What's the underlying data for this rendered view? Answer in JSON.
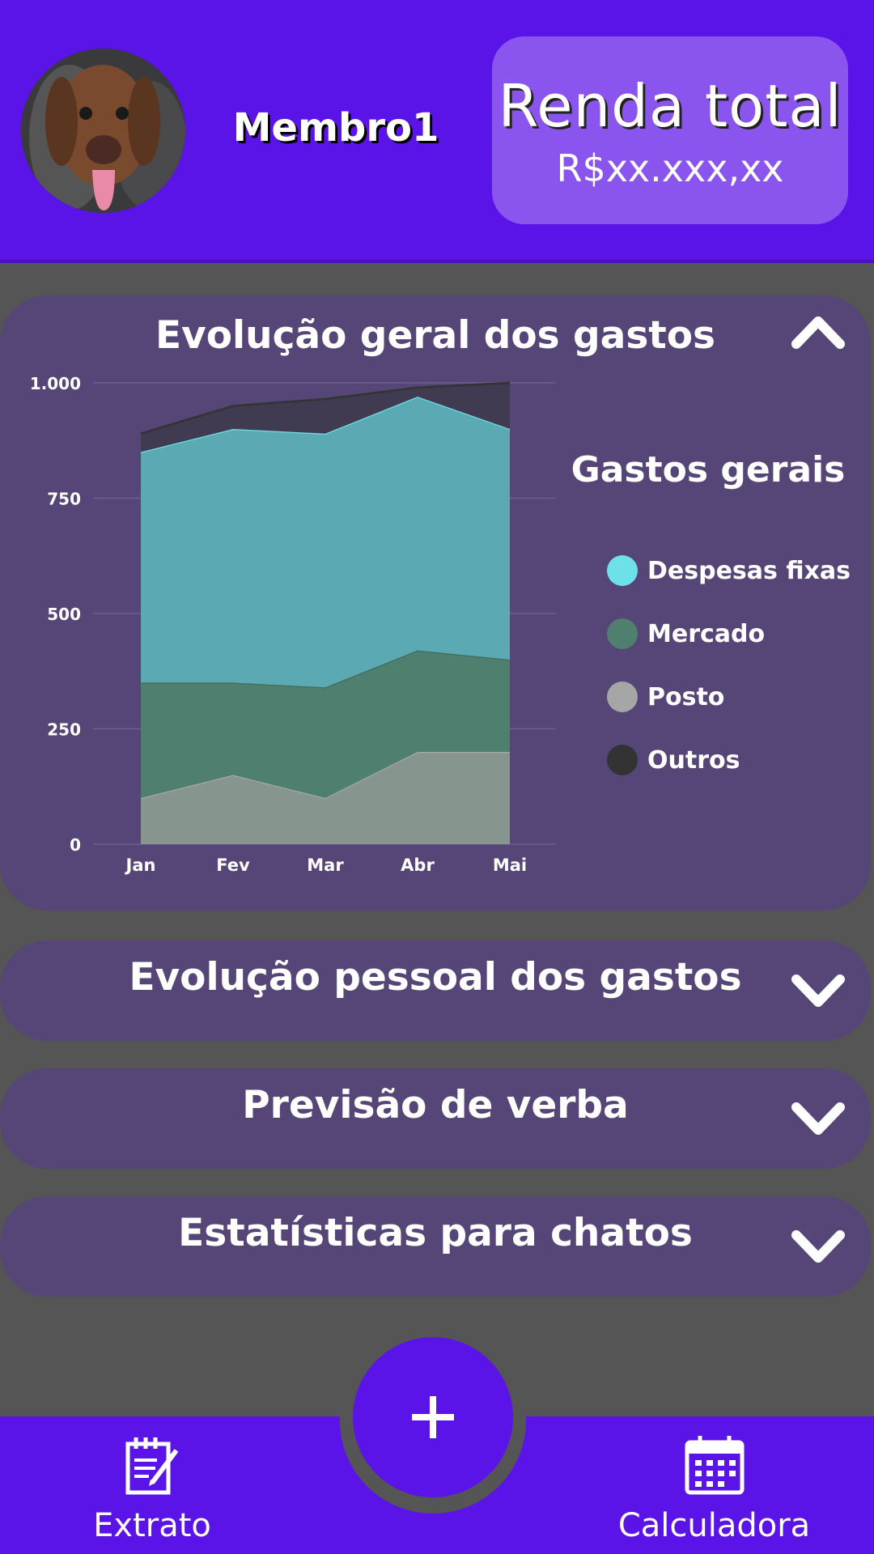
{
  "header": {
    "member_name": "Membro1",
    "income_title": "Renda total",
    "income_value": "R$xx.xxx,xx"
  },
  "sections": [
    {
      "title": "Evolução geral dos gastos",
      "expanded": true
    },
    {
      "title": "Evolução pessoal dos gastos",
      "expanded": false
    },
    {
      "title": "Previsão de verba",
      "expanded": false
    },
    {
      "title": "Estatísticas para chatos",
      "expanded": false
    }
  ],
  "legend": {
    "title": "Gastos gerais",
    "items": [
      "Despesas fixas",
      "Mercado",
      "Posto",
      "Outros"
    ]
  },
  "chart_data": {
    "type": "area",
    "stacked": true,
    "categories": [
      "Jan",
      "Fev",
      "Mar",
      "Abr",
      "Mai"
    ],
    "y_ticks": [
      "0",
      "250",
      "500",
      "750",
      "1.000"
    ],
    "ylim": [
      0,
      1000
    ],
    "grid": true,
    "legend_position": "right",
    "series": [
      {
        "name": "Posto",
        "values": [
          100,
          150,
          100,
          200,
          200
        ],
        "color": "#86968f"
      },
      {
        "name": "Mercado",
        "values": [
          250,
          200,
          240,
          220,
          200
        ],
        "color": "#4f7f6f"
      },
      {
        "name": "Despesas fixas",
        "values": [
          500,
          550,
          550,
          550,
          500
        ],
        "color": "#5ba9b3"
      },
      {
        "name": "Outros",
        "values": [
          40,
          50,
          75,
          20,
          100
        ],
        "color": "#413b52"
      }
    ]
  },
  "colors": {
    "brand": "#5b14e8",
    "card": "#8a55ee",
    "section": "#564577",
    "background": "#555555",
    "despesas_fixas": "#6ee0ea",
    "mercado": "#4f7f6f",
    "posto": "#a6a6a6",
    "outros": "#333333"
  },
  "icons": {
    "chevron_up": "chevron-up-icon",
    "chevron_down": "chevron-down-icon",
    "add": "plus-icon",
    "extrato": "notepad-pencil-icon",
    "calculadora": "calendar-icon"
  },
  "nav": {
    "extrato_label": "Extrato",
    "calculadora_label": "Calculadora"
  }
}
